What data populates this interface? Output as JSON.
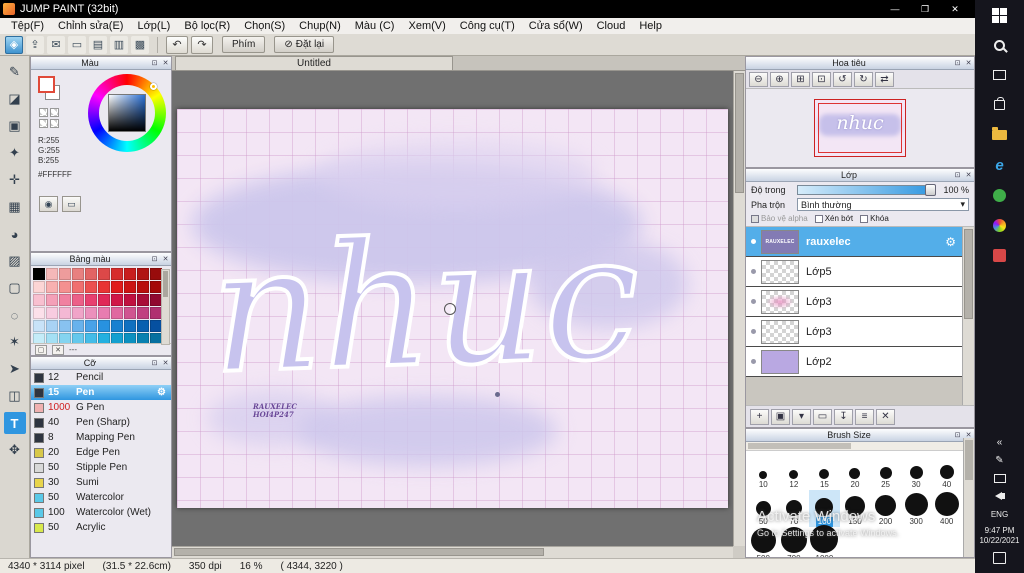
{
  "titlebar": {
    "title": "JUMP PAINT (32bit)",
    "minimize": "—",
    "maximize": "❐",
    "close": "✕"
  },
  "menubar": {
    "items": [
      "Tệp(F)",
      "Chỉnh sửa(E)",
      "Lớp(L)",
      "Bộ lọc(R)",
      "Chọn(S)",
      "Chụp(N)",
      "Màu (C)",
      "Xem(V)",
      "Công cụ(T)",
      "Cửa sổ(W)",
      "Cloud",
      "Help"
    ]
  },
  "toolbar": {
    "icons": [
      {
        "name": "paint-mode-icon",
        "glyph": "◈",
        "accent": true
      },
      {
        "name": "publish-icon",
        "glyph": "⇪"
      },
      {
        "name": "comment-icon",
        "glyph": "✉"
      },
      {
        "name": "display-icon",
        "glyph": "▭"
      },
      {
        "name": "page-icon",
        "glyph": "▤"
      },
      {
        "name": "pages-icon",
        "glyph": "▥"
      },
      {
        "name": "material-grid-icon",
        "glyph": "▩"
      }
    ],
    "undo": "↶",
    "redo": "↷",
    "phim_label": "Phím",
    "reset_icon": "⊘",
    "reset_label": "Đặt lại"
  },
  "tools": {
    "items": [
      {
        "name": "pen-tool",
        "glyph": "✎"
      },
      {
        "name": "eraser-tool",
        "glyph": "◪"
      },
      {
        "name": "stamp-tool",
        "glyph": "▣"
      },
      {
        "name": "snap-tool",
        "glyph": "✦"
      },
      {
        "name": "move-tool",
        "glyph": "✛"
      },
      {
        "name": "shape-brush-tool",
        "glyph": "▦"
      },
      {
        "name": "bucket-tool",
        "glyph": "◕"
      },
      {
        "name": "gradient-tool",
        "glyph": "▨"
      },
      {
        "name": "select-tool",
        "glyph": "▢"
      },
      {
        "name": "lasso-tool",
        "glyph": "◌"
      },
      {
        "name": "magic-wand-tool",
        "glyph": "✶"
      },
      {
        "name": "operation-tool",
        "glyph": "➤"
      },
      {
        "name": "divide-tool",
        "glyph": "◫"
      },
      {
        "name": "text-tool",
        "glyph": "T",
        "selected": true
      },
      {
        "name": "hand-tool",
        "glyph": "✥"
      }
    ]
  },
  "color_panel": {
    "title": "Màu",
    "r": "R:255",
    "g": "G:255",
    "b": "B:255",
    "hex": "#FFFFFF",
    "picker_icon": "◉",
    "slider_icon": "▭"
  },
  "palette_panel": {
    "title": "Bảng màu",
    "name_display": "---",
    "new_icon": "▢",
    "delete_icon": "✕",
    "colors": [
      "#000000",
      "#f4b8b8",
      "#ee9c9c",
      "#e88080",
      "#e26464",
      "#dc4848",
      "#d62c2c",
      "#c81e1e",
      "#b01414",
      "#980c0c",
      "#fcd5d5",
      "#f8b0b0",
      "#f49090",
      "#f07070",
      "#ec5050",
      "#e83434",
      "#e01c1c",
      "#cc1414",
      "#b80e0e",
      "#a40808",
      "#f8c0d0",
      "#f4a0b8",
      "#f080a0",
      "#ec6088",
      "#e84070",
      "#e02858",
      "#d01848",
      "#c01040",
      "#a80c38",
      "#900830",
      "#fce0ea",
      "#f8cce0",
      "#f4b8d4",
      "#f0a4c8",
      "#ec90bc",
      "#e87cb0",
      "#e068a0",
      "#d05490",
      "#c04080",
      "#b03070",
      "#c8e2f8",
      "#a8d2f4",
      "#88c2f0",
      "#68b2ec",
      "#48a2e8",
      "#2892e0",
      "#1880d0",
      "#1070c0",
      "#0860b0",
      "#0650a0",
      "#c4ecf8",
      "#a4e0f4",
      "#84d4f0",
      "#64c8ec",
      "#44bce8",
      "#24b0e0",
      "#14a0d0",
      "#0c90c0",
      "#0880b0",
      "#0670a0",
      "#c0ece4",
      "#9cdfd2",
      "#78d2c0",
      "#54c5ae",
      "#30b89c",
      "#1caa8c",
      "#14987c",
      "#0c866c",
      "#08745c",
      "#06624c"
    ]
  },
  "size_panel": {
    "title": "Cỡ",
    "items": [
      {
        "size": "12",
        "name": "Pencil",
        "color": "#2e3440"
      },
      {
        "size": "15",
        "name": "Pen",
        "color": "#2e3440",
        "selected": true
      },
      {
        "size": "1000",
        "name": "G Pen",
        "color": "#f0b0b0",
        "red": true
      },
      {
        "size": "40",
        "name": "Pen (Sharp)",
        "color": "#2e3440"
      },
      {
        "size": "8",
        "name": "Mapping Pen",
        "color": "#2e3440"
      },
      {
        "size": "20",
        "name": "Edge Pen",
        "color": "#d8c84a"
      },
      {
        "size": "50",
        "name": "Stipple Pen",
        "color": "#d8d8d8"
      },
      {
        "size": "30",
        "name": "Sumi",
        "color": "#e8d44c"
      },
      {
        "size": "50",
        "name": "Watercolor",
        "color": "#5ac8e8"
      },
      {
        "size": "100",
        "name": "Watercolor (Wet)",
        "color": "#5ac8e8"
      },
      {
        "size": "50",
        "name": "Acrylic",
        "color": "#d8e84c"
      }
    ]
  },
  "canvas": {
    "tab": "Untitled",
    "lettering": "nhuc",
    "watermark_line1": "RAUXELEC",
    "watermark_line2": "HOI4P247"
  },
  "navigator": {
    "title": "Hoa tiêu",
    "buttons": [
      {
        "name": "zoom-out-button",
        "glyph": "⊖"
      },
      {
        "name": "zoom-in-button",
        "glyph": "⊕"
      },
      {
        "name": "fit-window-button",
        "glyph": "⊞"
      },
      {
        "name": "actual-size-button",
        "glyph": "⊡"
      },
      {
        "name": "rotate-left-button",
        "glyph": "↺"
      },
      {
        "name": "rotate-right-button",
        "glyph": "↻"
      },
      {
        "name": "flip-button",
        "glyph": "⇄"
      }
    ]
  },
  "layers": {
    "title": "Lớp",
    "opacity_label": "Độ trong",
    "opacity_value": "100 %",
    "blend_label": "Pha trộn",
    "blend_value": "Bình thường",
    "dropdown_icon": "▾",
    "checkboxes": [
      {
        "label": "Bảo vệ alpha",
        "disabled": true
      },
      {
        "label": "Xén bớt"
      },
      {
        "label": "Khóa"
      }
    ],
    "items": [
      {
        "name": "rauxelec",
        "selected": true,
        "thumb": "label",
        "thumb_text": "RAUXELEC"
      },
      {
        "name": "Lớp5",
        "thumb": "checker"
      },
      {
        "name": "Lớp3",
        "thumb": "checker-pink"
      },
      {
        "name": "Lớp3",
        "thumb": "checker"
      },
      {
        "name": "Lớp2",
        "thumb": "solid",
        "thumb_color": "#b9a8e2"
      }
    ],
    "buttons": [
      {
        "name": "add-layer-button",
        "glyph": "+"
      },
      {
        "name": "duplicate-layer-button",
        "glyph": "▣"
      },
      {
        "name": "layer-menu-button",
        "glyph": "▾"
      },
      {
        "name": "add-folder-button",
        "glyph": "▭"
      },
      {
        "name": "transfer-layer-button",
        "glyph": "↧"
      },
      {
        "name": "combine-layer-button",
        "glyph": "≡"
      },
      {
        "name": "delete-layer-button",
        "glyph": "✕"
      }
    ]
  },
  "brush_size": {
    "title": "Brush Size",
    "items": [
      {
        "size": 10
      },
      {
        "size": 12
      },
      {
        "size": 15
      },
      {
        "size": 20
      },
      {
        "size": 25
      },
      {
        "size": 30
      },
      {
        "size": 40
      },
      {
        "size": 50
      },
      {
        "size": 70
      },
      {
        "size": 100,
        "selected": true
      },
      {
        "size": 150
      },
      {
        "size": 200
      },
      {
        "size": 300
      },
      {
        "size": 400
      },
      {
        "size": 500
      },
      {
        "size": 700
      },
      {
        "size": 1000
      }
    ]
  },
  "panel_icons": {
    "float": "⊡",
    "close": "✕"
  },
  "statusbar": {
    "parts": [
      "4340 * 3114 pixel",
      "(31.5 * 22.6cm)",
      "350 dpi",
      "16 %",
      "( 4344, 3220 )"
    ]
  },
  "taskbar": {
    "lang": "ENG",
    "time": "9:47 PM",
    "date": "10/22/2021",
    "chevron": "«",
    "pen": "✎"
  },
  "activate": {
    "line1": "Activate Windows",
    "line2": "Go to Settings to activate Windows."
  }
}
